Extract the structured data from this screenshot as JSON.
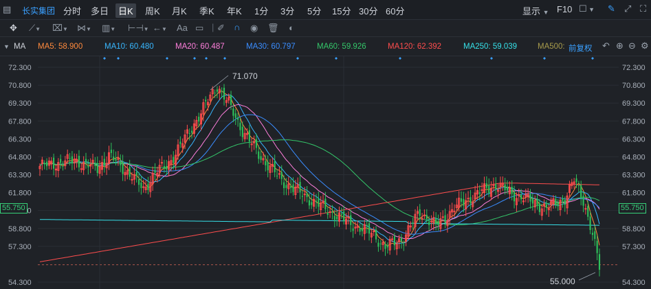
{
  "header": {
    "stock_name": "长实集团",
    "period_tabs": [
      "分时",
      "多日",
      "日K",
      "周K",
      "月K",
      "季K",
      "年K",
      "1分",
      "3分",
      "5分",
      "15分",
      "30分",
      "60分"
    ],
    "active_tab": "日K",
    "display_label": "显示",
    "f10_label": "F10"
  },
  "toolbar": {
    "text_tool_label": "Aa"
  },
  "ma_bar": {
    "indicator_label": "MA",
    "items": [
      {
        "label": "MA5: 58.900",
        "color": "#ff8a3d"
      },
      {
        "label": "MA10: 60.480",
        "color": "#38b7ff"
      },
      {
        "label": "MA20: 60.487",
        "color": "#ff7fdc"
      },
      {
        "label": "MA30: 60.797",
        "color": "#3a8dff"
      },
      {
        "label": "MA60: 59.926",
        "color": "#34c76a"
      },
      {
        "label": "MA120: 62.392",
        "color": "#ff4d4d"
      },
      {
        "label": "MA250: 59.039",
        "color": "#36e0e8"
      },
      {
        "label": "MA500:",
        "color": "#a89c4c"
      }
    ],
    "adjust_label": "前复权"
  },
  "chart_data": {
    "type": "candlestick",
    "y_ticks": [
      "72.300",
      "70.800",
      "69.300",
      "67.800",
      "66.300",
      "64.800",
      "63.300",
      "61.800",
      "60.300",
      "58.800",
      "57.300",
      "55.750",
      "54.300"
    ],
    "ylim": [
      54.3,
      72.3
    ],
    "current_price": "55.750",
    "high_annotation": "71.070",
    "low_annotation": "55.000",
    "up_color": "#ff4d4d",
    "down_color": "#2ec05a"
  }
}
